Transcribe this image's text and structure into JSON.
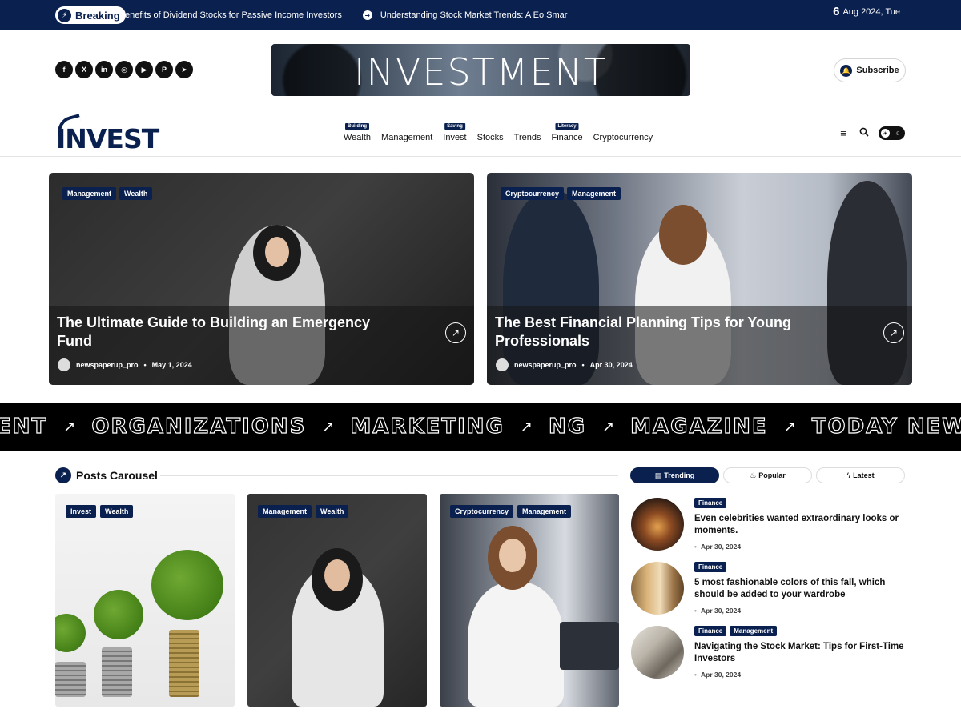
{
  "topbar": {
    "breaking_label": "Breaking",
    "ticker": [
      "enefits of Dividend Stocks for Passive Income Investors",
      "Understanding Stock Market Trends: A Eo Smar"
    ],
    "date_day": "6",
    "date_rest": "Aug 2024, Tue"
  },
  "social": [
    "facebook",
    "x",
    "linkedin",
    "instagram",
    "youtube",
    "pinterest",
    "telegram"
  ],
  "banner_text": "INVESTMENT",
  "subscribe_label": "Subscribe",
  "logo_text": "INVEST",
  "nav": [
    {
      "label": "Wealth",
      "tag": "Building"
    },
    {
      "label": "Management",
      "tag": ""
    },
    {
      "label": "Invest",
      "tag": "Saving"
    },
    {
      "label": "Stocks",
      "tag": ""
    },
    {
      "label": "Trends",
      "tag": ""
    },
    {
      "label": "Finance",
      "tag": "Literacy"
    },
    {
      "label": "Cryptocurrency",
      "tag": ""
    }
  ],
  "hero": [
    {
      "tags": [
        "Management",
        "Wealth"
      ],
      "title": "The Ultimate Guide to Building an Emergency Fund",
      "author": "newspaperup_pro",
      "date": "May 1, 2024"
    },
    {
      "tags": [
        "Cryptocurrency",
        "Management"
      ],
      "title": "The Best Financial Planning Tips for Young Professionals",
      "author": "newspaperup_pro",
      "date": "Apr 30, 2024"
    }
  ],
  "band_words": [
    "ENT",
    "ORGANIZATIONS",
    "MARKETING",
    "NG",
    "MAGAZINE",
    "TODAY NEWS"
  ],
  "carousel": {
    "title": "Posts Carousel",
    "cards": [
      {
        "tags": [
          "Invest",
          "Wealth"
        ]
      },
      {
        "tags": [
          "Management",
          "Wealth"
        ]
      },
      {
        "tags": [
          "Cryptocurrency",
          "Management"
        ]
      }
    ]
  },
  "sidebar": {
    "tabs": [
      "Trending",
      "Popular",
      "Latest"
    ],
    "posts": [
      {
        "tags": [
          "Finance"
        ],
        "title": "Even celebrities wanted extraordinary looks or moments.",
        "date": "Apr 30, 2024"
      },
      {
        "tags": [
          "Finance"
        ],
        "title": "5 most fashionable colors of this fall, which should be added to your wardrobe",
        "date": "Apr 30, 2024"
      },
      {
        "tags": [
          "Finance",
          "Management"
        ],
        "title": "Navigating the Stock Market: Tips for First-Time Investors",
        "date": "Apr 30, 2024"
      }
    ]
  },
  "colors": {
    "brand": "#0a2150"
  }
}
